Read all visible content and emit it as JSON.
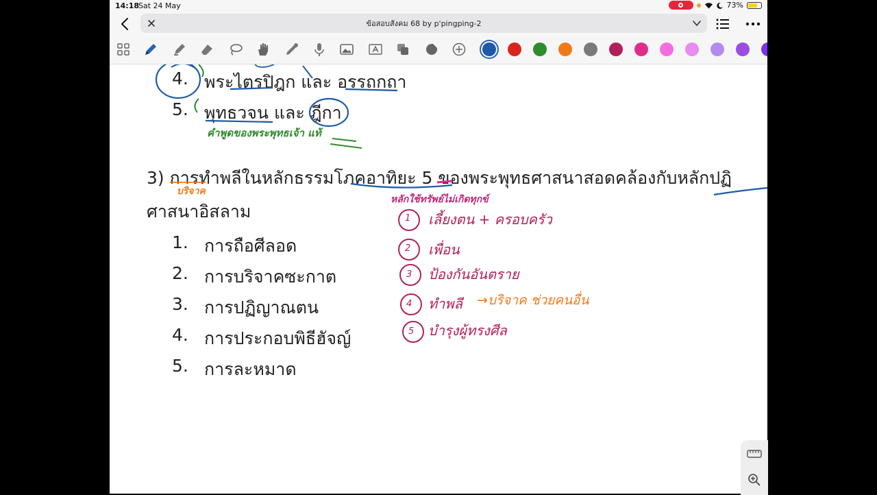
{
  "status_bar": {
    "time": "14:18",
    "date": "Sat 24 May",
    "battery": "73%",
    "battery_level": 0.73
  },
  "nav": {
    "title": "ข้อสอบสังคม 68 by p'pingping-2"
  },
  "toolbar": {
    "tools": [
      "grid-icon",
      "pen-icon",
      "highlighter-icon",
      "eraser-icon",
      "lasso-icon",
      "hand-icon",
      "pipette-icon",
      "mic-icon",
      "image-icon",
      "textbox-icon",
      "shapes-icon",
      "sticker-icon",
      "add-icon"
    ],
    "colors": [
      "#1e5aa8",
      "#d9261c",
      "#2e8b2e",
      "#f07a1a",
      "#7a7a7a",
      "#b0205a",
      "#e02d8c",
      "#f36fe0",
      "#e88cf0",
      "#b48cf0",
      "#9a4de0",
      "#7b2ff0"
    ],
    "selected_color_index": 0
  },
  "content": {
    "top_items": [
      {
        "num": "4.",
        "text": "พระไตรปิฎก และ อรรถกถา"
      },
      {
        "num": "5.",
        "text": "พุทธวจน และ ฎีกา"
      }
    ],
    "note_green": "คำพูดของพระพุทธเจ้า แท้",
    "question": "3)  การทำพลีในหลักธรรมโภคอาทิยะ 5 ของพระพุทธศาสนาสอดคล้องกับหลักปฏิ",
    "question_line2": "ศาสนาอิสลาม",
    "note_orange_q": "บริจาค",
    "options": [
      {
        "num": "1.",
        "text": "การถือศีลอด"
      },
      {
        "num": "2.",
        "text": "การบริจาคซะกาต"
      },
      {
        "num": "3.",
        "text": "การปฏิญาณตน"
      },
      {
        "num": "4.",
        "text": "การประกอบพิธีฮัจญ์"
      },
      {
        "num": "5.",
        "text": "การละหมาด"
      }
    ],
    "note_header": "หลักใช้ทรัพย์ไม่เกิดทุกข์",
    "notes": [
      {
        "n": "1",
        "text": "เลี้ยงตน + ครอบครัว"
      },
      {
        "n": "2",
        "text": "เพื่อน"
      },
      {
        "n": "3",
        "text": "ป้องกันอันตราย"
      },
      {
        "n": "4",
        "text": "ทำพลี",
        "extra": "→บริจาค ช่วยคนอื่น"
      },
      {
        "n": "5",
        "text": "บำรุงผู้ทรงศีล"
      }
    ]
  }
}
